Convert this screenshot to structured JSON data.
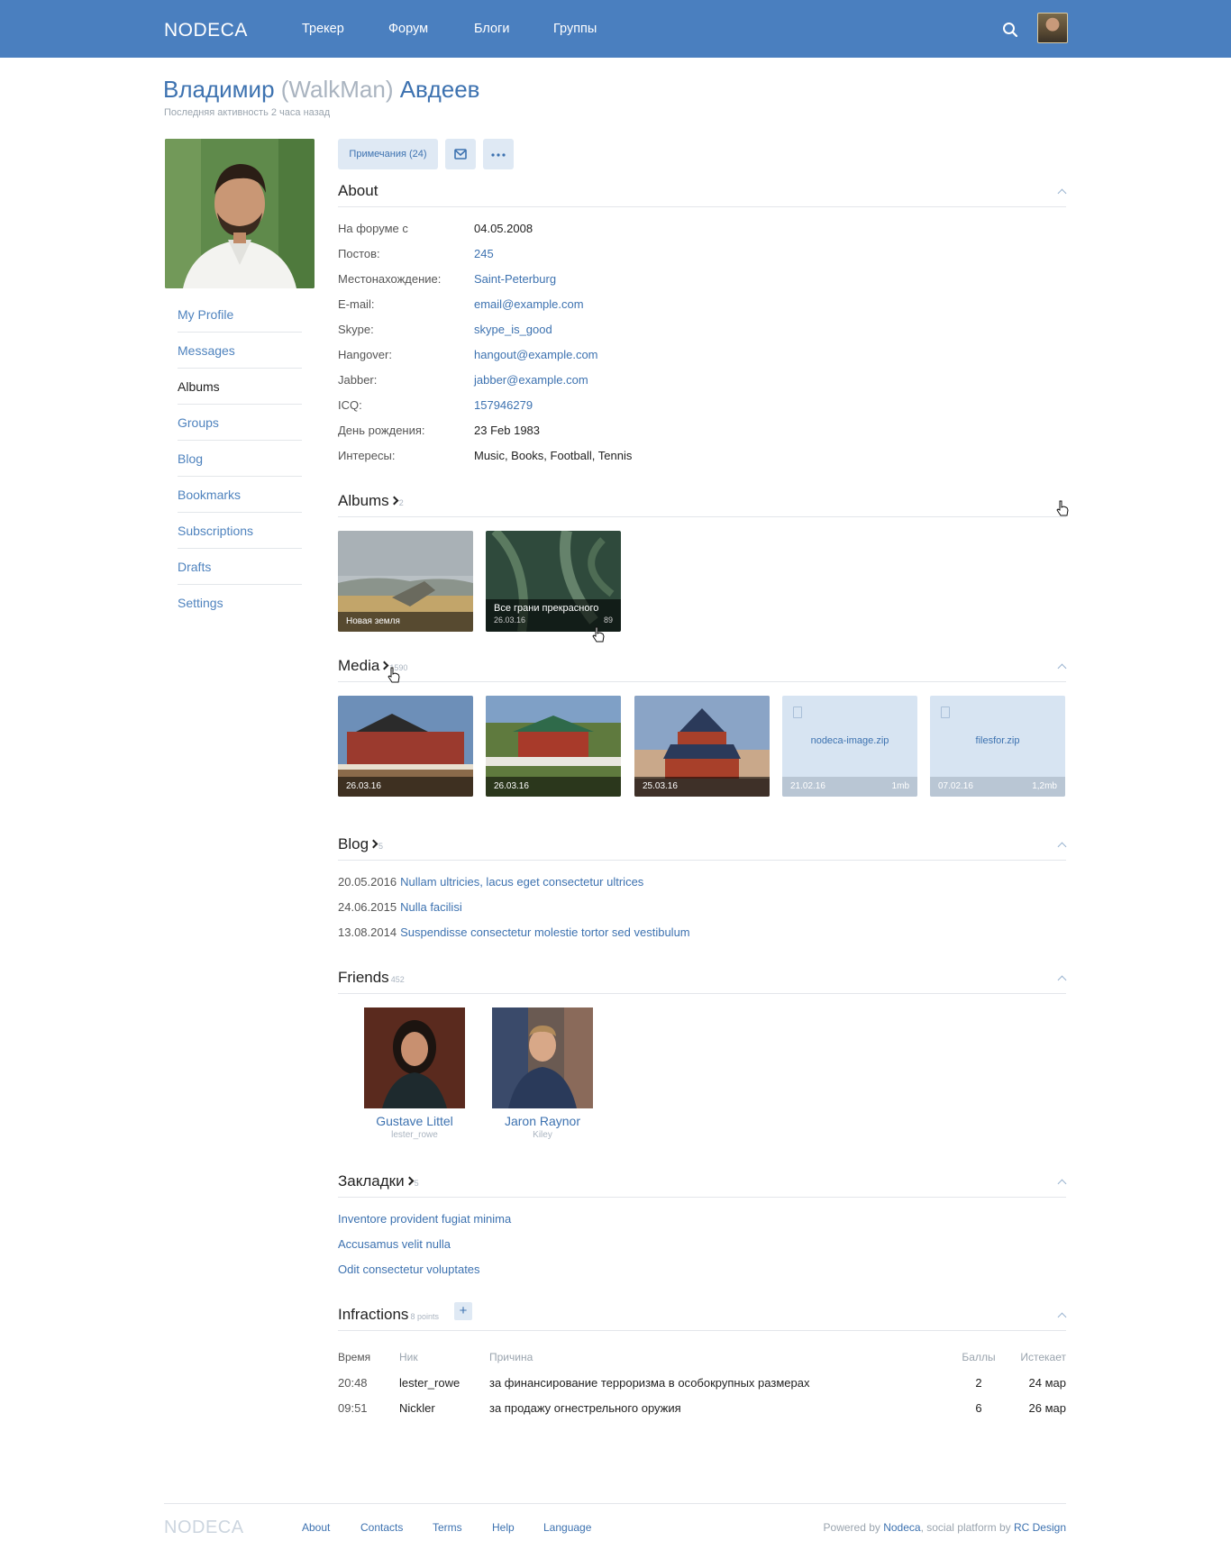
{
  "header": {
    "logo": "NODECA",
    "nav": [
      "Трекер",
      "Форум",
      "Блоги",
      "Группы"
    ]
  },
  "profile": {
    "first_name": "Владимир",
    "nick": "(WalkMan)",
    "last_name": "Авдеев",
    "last_activity": "Последняя активность 2 часа назад"
  },
  "sidebar": {
    "items": [
      {
        "label": "My Profile",
        "active": false
      },
      {
        "label": "Messages",
        "active": false
      },
      {
        "label": "Albums",
        "active": true
      },
      {
        "label": "Groups",
        "active": false
      },
      {
        "label": "Blog",
        "active": false
      },
      {
        "label": "Bookmarks",
        "active": false
      },
      {
        "label": "Subscriptions",
        "active": false
      },
      {
        "label": "Drafts",
        "active": false
      },
      {
        "label": "Settings",
        "active": false
      }
    ]
  },
  "actions": {
    "notes_label": "Примечания (24)"
  },
  "about": {
    "title": "About",
    "rows": [
      {
        "k": "На форуме с",
        "v": "04.05.2008",
        "link": false
      },
      {
        "k": "Постов:",
        "v": "245",
        "link": true
      },
      {
        "k": "Местонахождение:",
        "v": "Saint-Peterburg",
        "link": true
      },
      {
        "k": "E-mail:",
        "v": "email@example.com",
        "link": true
      },
      {
        "k": "Skype:",
        "v": "skype_is_good",
        "link": true
      },
      {
        "k": "Hangover:",
        "v": "hangout@example.com",
        "link": true
      },
      {
        "k": "Jabber:",
        "v": "jabber@example.com",
        "link": true
      },
      {
        "k": "ICQ:",
        "v": "157946279",
        "link": true
      },
      {
        "k": "День рождения:",
        "v": "23 Feb 1983",
        "link": false
      },
      {
        "k": "Интересы:",
        "v": "Music, Books, Football, Tennis",
        "link": false
      }
    ]
  },
  "albums": {
    "title": "Albums",
    "count": "2",
    "items": [
      {
        "name": "Новая земля",
        "date": "",
        "count": ""
      },
      {
        "name": "Все грани прекрасного",
        "date": "26.03.16",
        "count": "89"
      }
    ]
  },
  "media": {
    "title": "Media",
    "count": "1590",
    "items": [
      {
        "type": "image",
        "date": "26.03.16"
      },
      {
        "type": "image",
        "date": "26.03.16"
      },
      {
        "type": "image",
        "date": "25.03.16"
      },
      {
        "type": "file",
        "name": "nodeca-image.zip",
        "date": "21.02.16",
        "size": "1mb"
      },
      {
        "type": "file",
        "name": "filesfor.zip",
        "date": "07.02.16",
        "size": "1,2mb"
      }
    ]
  },
  "blog": {
    "title": "Blog",
    "count": "5",
    "posts": [
      {
        "date": "20.05.2016",
        "title": "Nullam ultricies, lacus eget consectetur ultrices"
      },
      {
        "date": "24.06.2015",
        "title": "Nulla facilisi"
      },
      {
        "date": "13.08.2014",
        "title": "Suspendisse consectetur molestie tortor sed vestibulum"
      }
    ]
  },
  "friends": {
    "title": "Friends",
    "count": "452",
    "items": [
      {
        "name": "Gustave Littel",
        "username": "lester_rowe"
      },
      {
        "name": "Jaron Raynor",
        "username": "Kiley"
      }
    ]
  },
  "bookmarks": {
    "title": "Закладки",
    "count": "5",
    "items": [
      "Inventore provident fugiat minima",
      "Accusamus velit nulla",
      "Odit consectetur voluptates"
    ]
  },
  "infractions": {
    "title": "Infractions",
    "points": "8 points",
    "columns": [
      "Время",
      "Ник",
      "Причина",
      "Баллы",
      "Истекает"
    ],
    "rows": [
      {
        "time": "20:48",
        "nick": "lester_rowe",
        "reason": "за финансирование терроризма в особокрупных размерах",
        "points": "2",
        "expires": "24 мар"
      },
      {
        "time": "09:51",
        "nick": "Nickler",
        "reason": "за продажу огнестрельного оружия",
        "points": "6",
        "expires": "26 мар"
      }
    ]
  },
  "footer": {
    "logo": "NODECA",
    "links": [
      "About",
      "Contacts",
      "Terms",
      "Help",
      "Language"
    ],
    "powered_prefix": "Powered by ",
    "powered_brand": "Nodeca",
    "powered_mid": ", social platform by ",
    "powered_company": "RC Design"
  },
  "colors": {
    "header_bg": "#4a7fbf",
    "link": "#3d72b0",
    "button_bg": "#dfe9f4"
  }
}
